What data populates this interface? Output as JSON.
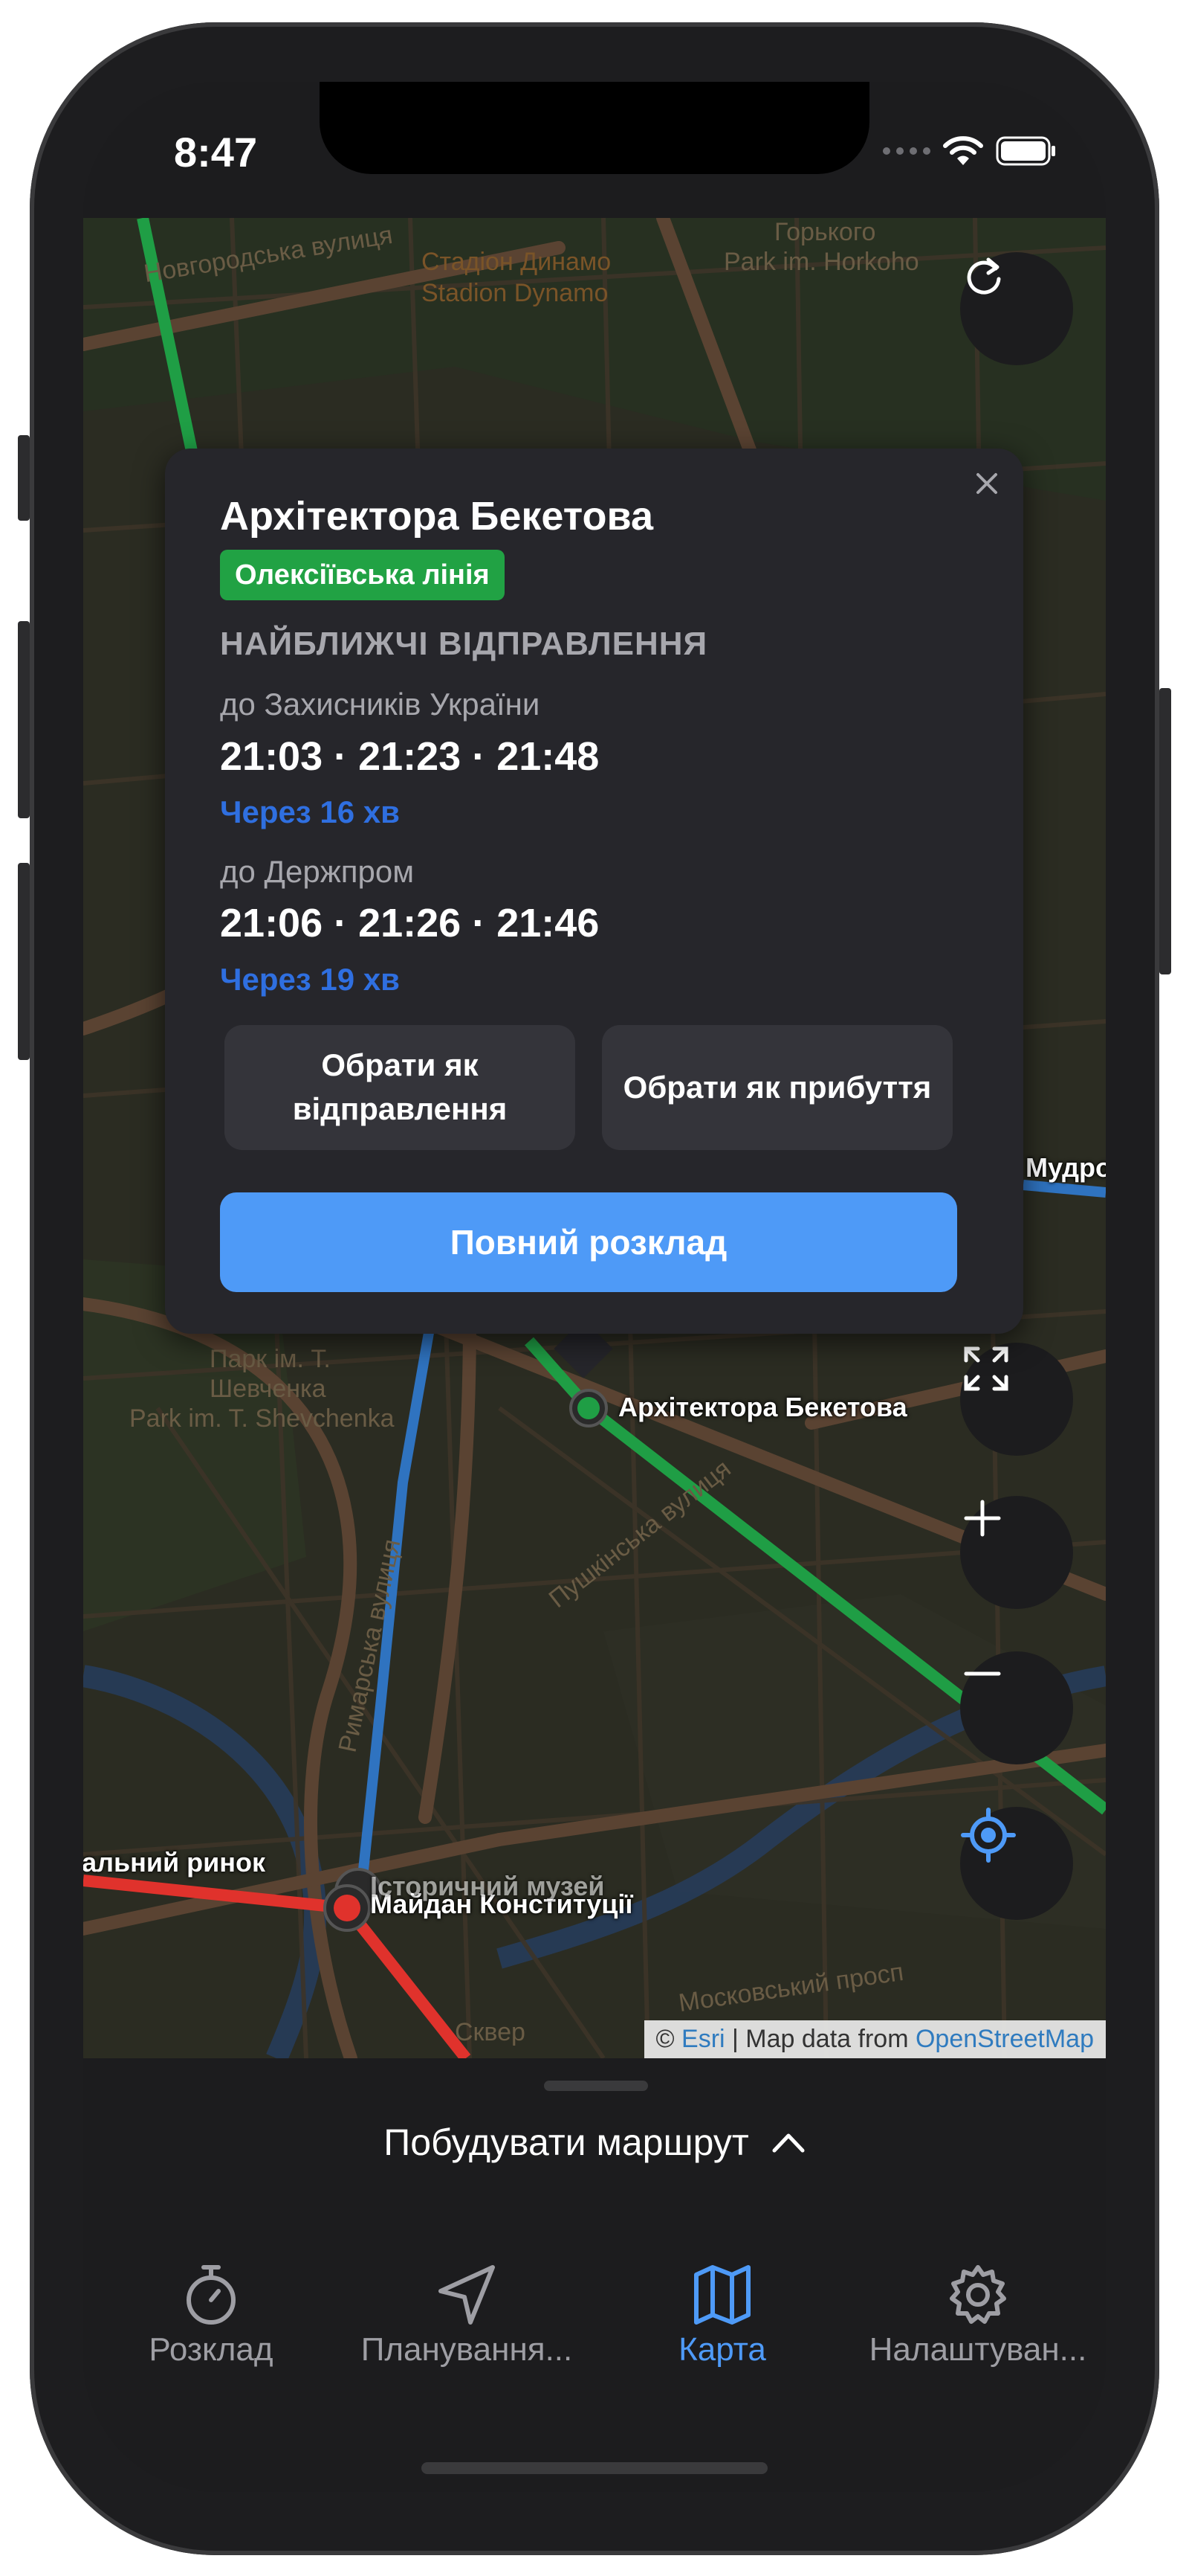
{
  "status_bar": {
    "time": "8:47"
  },
  "map": {
    "stations": {
      "beketova": "Архітектора Бекетова",
      "maidan": "Майдан Конституції",
      "museum": "Історичний музей",
      "rynok": "Центральний ринок",
      "mudro": "Мудро"
    },
    "background_labels": {
      "novhorodska": "Новгородська вулиця",
      "stadium": "Стадіон Динамо",
      "stadium_en": "Stadion Dynamo",
      "gorky": "Горького",
      "gorky_en": "Park im. Horkoho",
      "park": "Парк ім. Т.",
      "park2": "Шевченка",
      "park_en": "Park im. T. Shevchenka",
      "pushkinska": "Пушкінська вулиця",
      "rymarska": "Римарська вулиця",
      "moskovskyi": "Московський просп",
      "skver": "Сквер"
    },
    "attribution": {
      "copyright": "©",
      "esri": "Esri",
      "separator": " | Map data from ",
      "osm": "OpenStreetMap"
    },
    "line_colors": {
      "green": "#1f9e45",
      "blue": "#2f73c0",
      "red": "#e0322c"
    }
  },
  "popup": {
    "title": "Архітектора Бекетова",
    "line_badge": "Олексіївська лінія",
    "section_heading": "НАЙБЛИЖЧІ ВІДПРАВЛЕННЯ",
    "departures": [
      {
        "direction": "до Захисників України",
        "times": "21:03 · 21:23 · 21:48",
        "eta": "Через 16 хв"
      },
      {
        "direction": "до Держпром",
        "times": "21:06 · 21:26 · 21:46",
        "eta": "Через 19 хв"
      }
    ],
    "select_departure": "Обрати як відправлення",
    "select_arrival": "Обрати як прибуття",
    "full_schedule": "Повний розклад"
  },
  "bottom_sheet": {
    "route_label": "Побудувати маршрут"
  },
  "tabbar": {
    "tabs": [
      {
        "label": "Розклад",
        "icon": "stopwatch-icon"
      },
      {
        "label": "Планування...",
        "icon": "navigation-arrow-icon"
      },
      {
        "label": "Карта",
        "icon": "map-icon",
        "active": true
      },
      {
        "label": "Налаштуван...",
        "icon": "gear-icon"
      }
    ],
    "active_color": "#4e9af7"
  }
}
